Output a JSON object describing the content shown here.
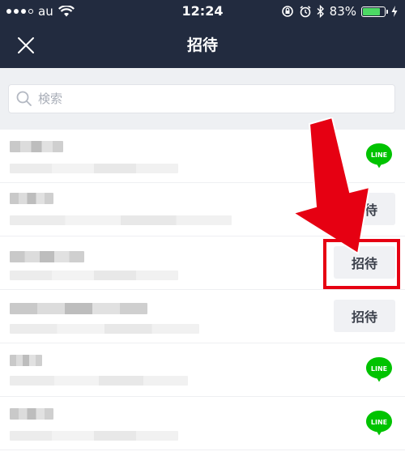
{
  "status_bar": {
    "carrier": "au",
    "time": "12:24",
    "battery_percent_text": "83%",
    "battery_level": 0.83
  },
  "nav": {
    "title": "招待",
    "close_icon": "close-icon"
  },
  "search": {
    "placeholder": "検索",
    "value": ""
  },
  "rows": [
    {
      "action": "line-badge",
      "badge_text": "LINE"
    },
    {
      "action": "invite",
      "button_label": "招待"
    },
    {
      "action": "invite",
      "button_label": "招待"
    },
    {
      "action": "invite",
      "button_label": "招待"
    },
    {
      "action": "line-badge",
      "badge_text": "LINE"
    },
    {
      "action": "line-badge",
      "badge_text": "LINE"
    }
  ],
  "colors": {
    "header_bg": "#222b3f",
    "search_bg": "#eef0f3",
    "line_green": "#00c300",
    "annotation_red": "#e60012",
    "battery_green": "#4cd964"
  }
}
